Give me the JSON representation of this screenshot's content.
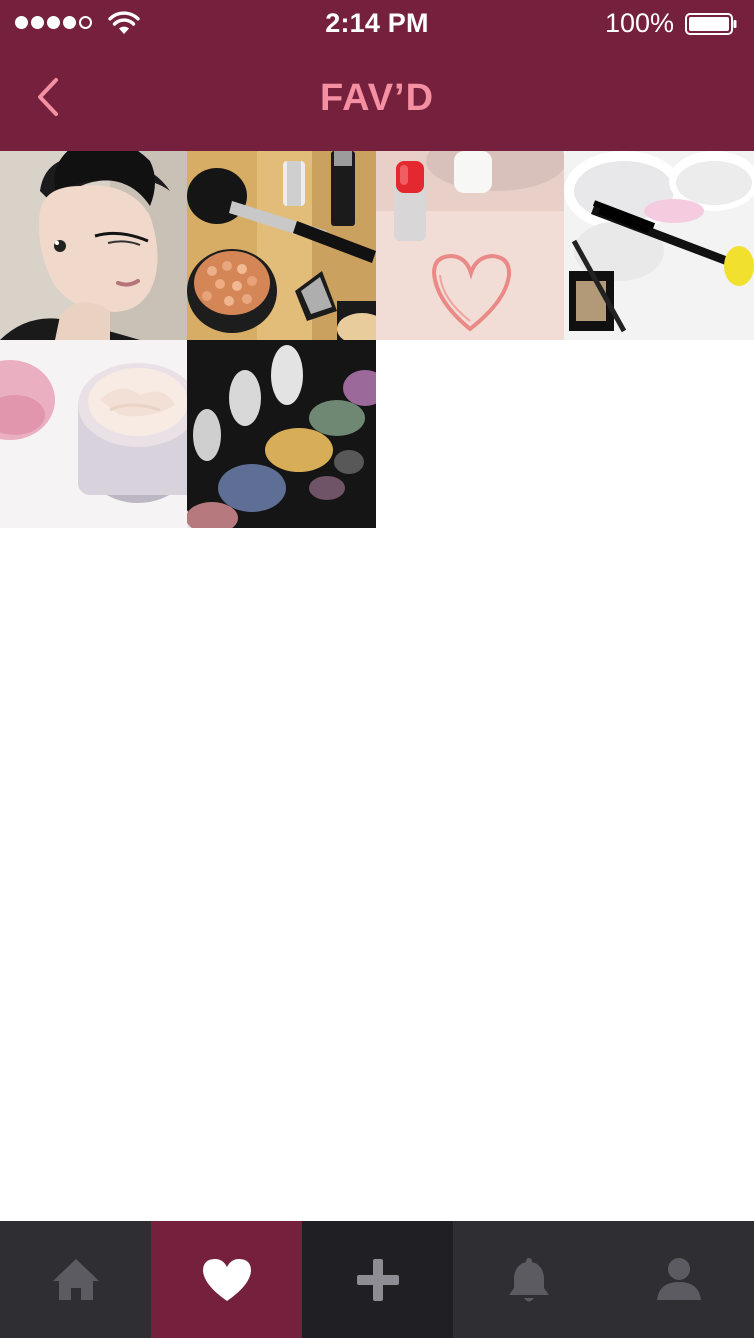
{
  "status_bar": {
    "time": "2:14 PM",
    "battery_percent": "100%",
    "signal_bars_filled": 4,
    "signal_bars_total": 5,
    "icons": [
      "signal-dots-icon",
      "wifi-icon",
      "battery-icon"
    ]
  },
  "header": {
    "title": "FAV’D",
    "back_icon": "chevron-left-icon",
    "background_color": "#75213e",
    "title_color": "#f58fa2"
  },
  "favorites": {
    "items": [
      {
        "subject": "woman with winged eyeliner makeup"
      },
      {
        "subject": "blush brush, bronzing pearls and cosmetics"
      },
      {
        "subject": "red lipstick with heart drawn on powder"
      },
      {
        "subject": "mascara wand over cosmetics"
      },
      {
        "subject": "open jar of face cream"
      },
      {
        "subject": "eyeshadow palette"
      }
    ]
  },
  "tab_bar": {
    "tabs": [
      {
        "name": "home",
        "icon": "home-icon",
        "active": false
      },
      {
        "name": "favorites",
        "icon": "heart-icon",
        "active": true
      },
      {
        "name": "add",
        "icon": "plus-icon",
        "active": false
      },
      {
        "name": "notifications",
        "icon": "bell-icon",
        "active": false
      },
      {
        "name": "profile",
        "icon": "person-icon",
        "active": false
      }
    ],
    "active_color": "#75213e",
    "background_color": "#2f2e33"
  }
}
